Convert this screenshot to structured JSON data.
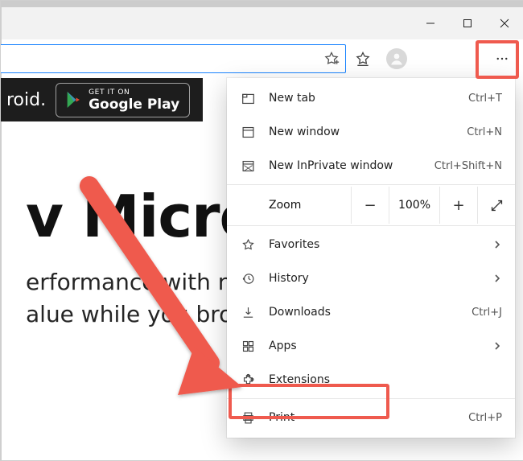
{
  "caption": {
    "min": "Minimize",
    "max": "Maximize",
    "close": "Close"
  },
  "toolbar": {
    "fav_add_icon": "add-favorite",
    "favorites_icon": "favorites",
    "profile_icon": "profile",
    "more_icon": "settings-and-more"
  },
  "promo": {
    "text": "roid.",
    "gplay_small": "GET IT ON",
    "gplay_big": "Google Play"
  },
  "hero": {
    "h1": "v Micros",
    "s1": "erformance with n",
    "s2": "alue while you bro"
  },
  "menu": {
    "new_tab": {
      "label": "New tab",
      "shortcut": "Ctrl+T"
    },
    "new_window": {
      "label": "New window",
      "shortcut": "Ctrl+N"
    },
    "new_inprivate": {
      "label": "New InPrivate window",
      "shortcut": "Ctrl+Shift+N"
    },
    "zoom": {
      "label": "Zoom",
      "value": "100%"
    },
    "favorites": {
      "label": "Favorites"
    },
    "history": {
      "label": "History"
    },
    "downloads": {
      "label": "Downloads",
      "shortcut": "Ctrl+J"
    },
    "apps": {
      "label": "Apps"
    },
    "extensions": {
      "label": "Extensions"
    },
    "print": {
      "label": "Print",
      "shortcut": "Ctrl+P"
    }
  }
}
